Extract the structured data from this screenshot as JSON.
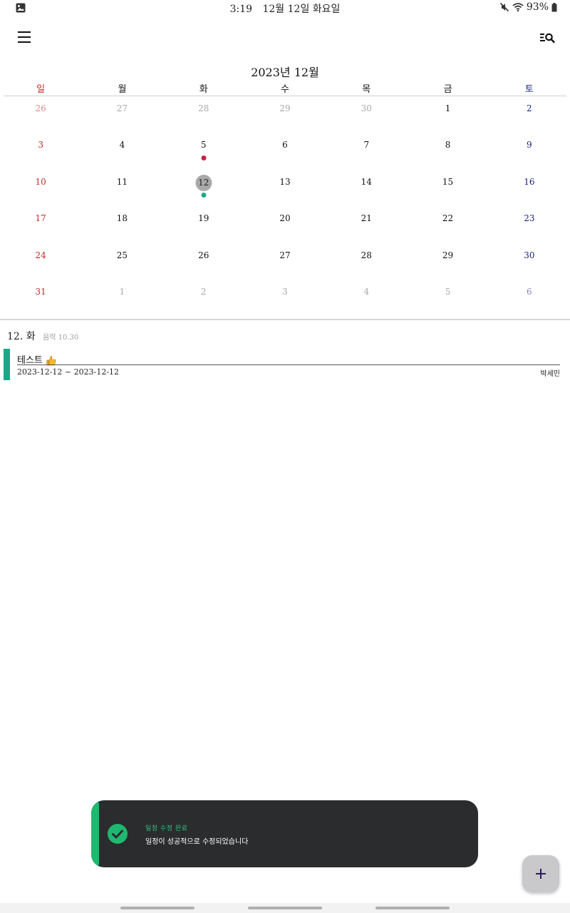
{
  "status_bar": {
    "time": "3:19",
    "date": "12월 12일 화요일",
    "battery": "93%",
    "icons": [
      "gallery-icon",
      "mute-icon",
      "wifi-icon",
      "battery-icon"
    ]
  },
  "app_bar": {
    "menu_icon": "menu-icon",
    "search_icon": "list-search-icon"
  },
  "calendar": {
    "month_title": "2023년 12월",
    "weekdays": [
      "일",
      "월",
      "화",
      "수",
      "목",
      "금",
      "토"
    ],
    "weeks": [
      [
        "26",
        "27",
        "28",
        "29",
        "30",
        "1",
        "2"
      ],
      [
        "3",
        "4",
        "5",
        "6",
        "7",
        "8",
        "9"
      ],
      [
        "10",
        "11",
        "12",
        "13",
        "14",
        "15",
        "16"
      ],
      [
        "17",
        "18",
        "19",
        "20",
        "21",
        "22",
        "23"
      ],
      [
        "24",
        "25",
        "26",
        "27",
        "28",
        "29",
        "30"
      ],
      [
        "31",
        "1",
        "2",
        "3",
        "4",
        "5",
        "6"
      ]
    ],
    "colors": {
      "sunday": "#c62828",
      "saturday": "#1a237e",
      "today_circle": "#a9a9a9",
      "dot_red": "#c2244a",
      "dot_green": "#1aa889"
    }
  },
  "day_detail": {
    "header": "12. 화",
    "lunar": "음력 10.30",
    "events": [
      {
        "title": "테스트",
        "date_range": "2023-12-12 ~ 2023-12-12",
        "owner": "박세민",
        "color": "#1aa889"
      }
    ]
  },
  "toast": {
    "title": "일정 수정 완료",
    "message": "일정이 성공적으로 수정되었습니다",
    "accent": "#1fb870"
  },
  "fab": {
    "icon": "plus-icon"
  }
}
